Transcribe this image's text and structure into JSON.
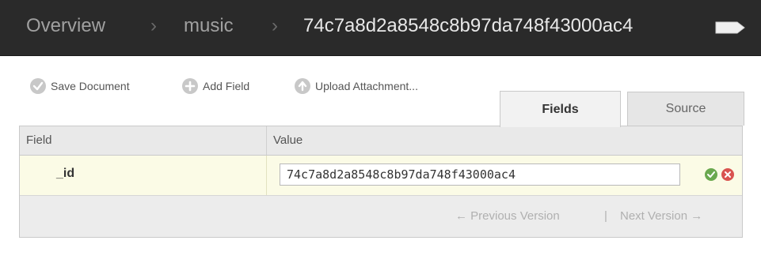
{
  "breadcrumb": {
    "items": [
      "Overview",
      "music",
      "74c7a8d2a8548c8b97da748f43000ac4"
    ],
    "separator": "›"
  },
  "toolbar": {
    "save_label": "Save Document",
    "add_field_label": "Add Field",
    "upload_label": "Upload Attachment..."
  },
  "tabs": {
    "fields": "Fields",
    "source": "Source"
  },
  "table": {
    "headers": {
      "field": "Field",
      "value": "Value"
    },
    "rows": [
      {
        "field": "_id",
        "value": "74c7a8d2a8548c8b97da748f43000ac4"
      }
    ]
  },
  "pager": {
    "previous": "← Previous Version",
    "divider": "|",
    "next": "Next Version →"
  },
  "colors": {
    "header_bg": "#2a2a2a",
    "row_highlight": "#fbfbe6",
    "ok_green": "#6aa84f",
    "cancel_red": "#d9534f"
  }
}
